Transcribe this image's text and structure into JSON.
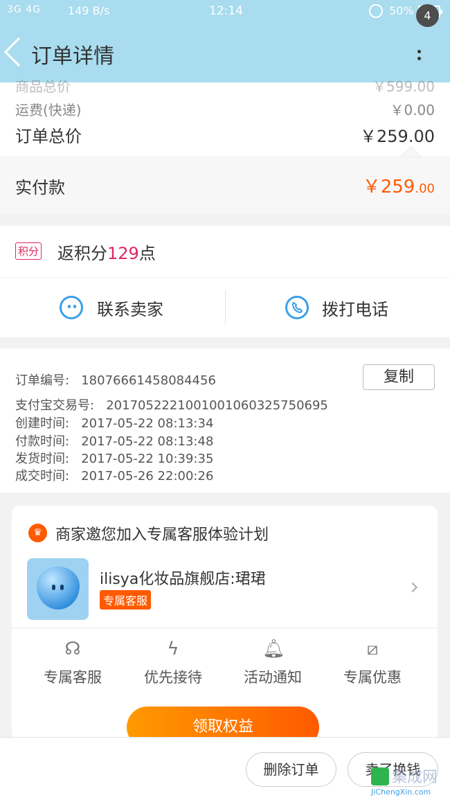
{
  "statusbar": {
    "signal": "3G 4G",
    "speed": "149 B/s",
    "time": "12:14",
    "battery": "50%"
  },
  "header": {
    "title": "订单详情",
    "badge_count": "4"
  },
  "prices": {
    "goods_total_label": "商品总价",
    "goods_total_value": "￥599.00",
    "shipping_label": "运费(快递)",
    "shipping_value": "￥0.00",
    "order_total_label": "订单总价",
    "order_total_value": "￥259.00",
    "paid_label": "实付款",
    "paid_value_main": "￥259",
    "paid_value_dec": ".00"
  },
  "points": {
    "tag": "积分",
    "prefix": "返积分",
    "amount": "129",
    "suffix": "点"
  },
  "contact": {
    "seller_label": "联系卖家",
    "phone_label": "拨打电话"
  },
  "order_info": {
    "order_no": "订单编号:   18076661458084456",
    "alipay_no": "支付宝交易号:   2017052221001001060325750695",
    "created": "创建时间:   2017-05-22 08:13:34",
    "paid": "付款时间:   2017-05-22 08:13:48",
    "shipped": "发货时间:   2017-05-22 10:39:35",
    "completed": "成交时间:   2017-05-26 22:00:26",
    "copy_label": "复制"
  },
  "service": {
    "title": "商家邀您加入专属客服体验计划",
    "shop_name": "ilisya化妆品旗舰店:珺珺",
    "shop_tag": "专属客服",
    "features": [
      "专属客服",
      "优先接待",
      "活动通知",
      "专属优惠"
    ],
    "claim_label": "领取权益"
  },
  "bottom": {
    "delete_label": "删除订单",
    "sell_label": "卖了换钱"
  },
  "watermark": {
    "text": "集成网",
    "url": "JiChengXin.com"
  },
  "colors": {
    "header_bg": "#a8dcee",
    "accent_orange": "#ff5a00",
    "points_red": "#e0245e",
    "link_blue": "#39a0e8"
  }
}
